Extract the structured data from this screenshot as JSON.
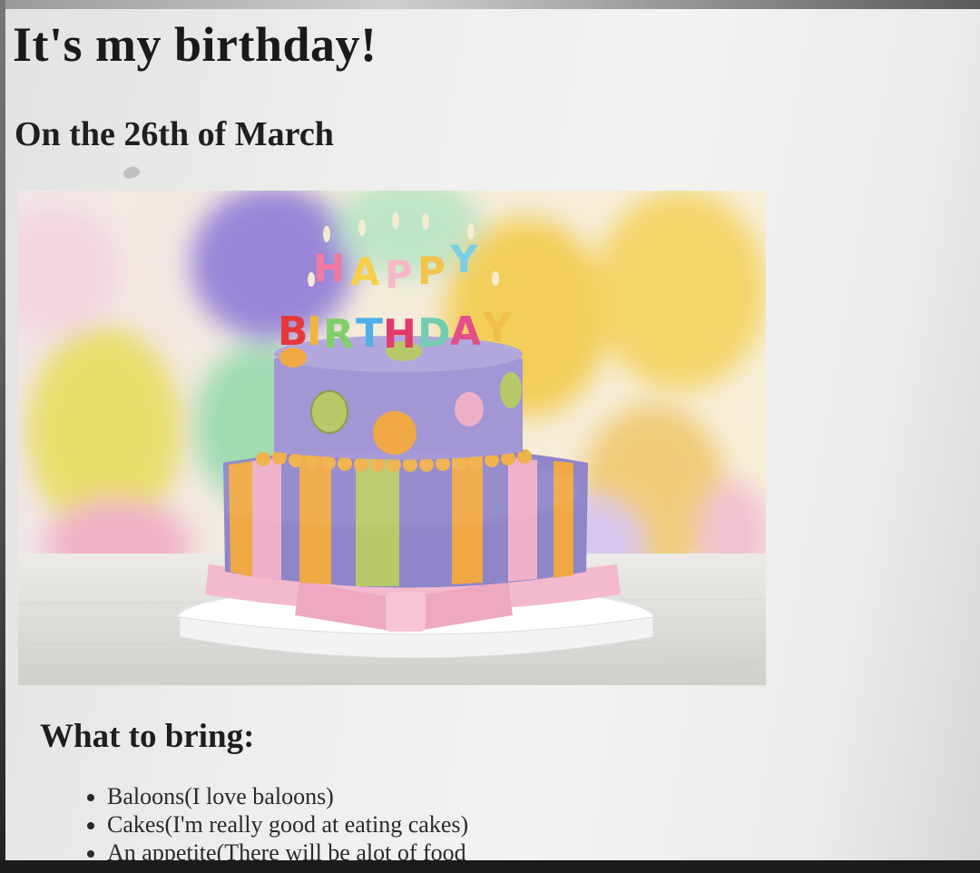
{
  "page": {
    "heading": "It's my birthday!",
    "subheading": "On the 26th of March",
    "image_subject": "birthday-cake",
    "cake_candles_top": [
      "H",
      "A",
      "P",
      "P",
      "Y"
    ],
    "cake_candles_bottom": [
      "B",
      "I",
      "R",
      "T",
      "H",
      "D",
      "A",
      "Y"
    ],
    "section_heading": "What to bring:",
    "bring_items": [
      "Baloons(I love baloons)",
      "Cakes(I'm really good at eating cakes)",
      "An appetite(There will be alot of food"
    ]
  },
  "colors": {
    "text": "#1a1a1a",
    "cake_purple": "#8f86c9",
    "cake_pink": "#eeb0c8",
    "cake_orange": "#f0a845",
    "cake_green": "#b8c96a"
  }
}
